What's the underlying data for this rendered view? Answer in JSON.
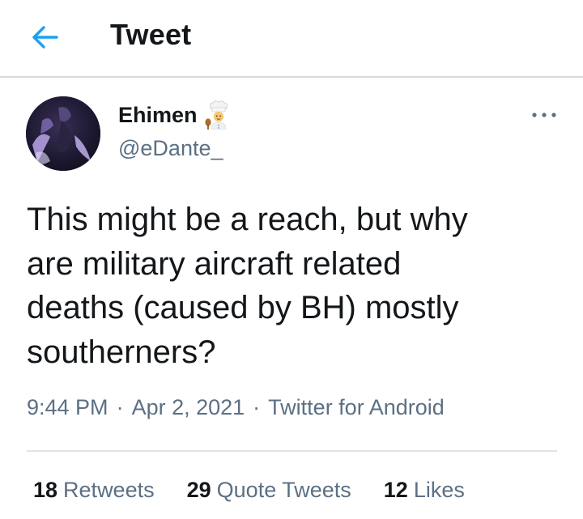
{
  "header": {
    "title": "Tweet",
    "back_icon": "arrow-left-icon"
  },
  "colors": {
    "accent": "#1da1f2",
    "text": "#14171a",
    "secondary": "#5b7083",
    "divider": "#e1e5e8"
  },
  "tweet": {
    "author": {
      "display_name": "Ehimen",
      "name_emoji": "cook-emoji",
      "handle": "@eDante_"
    },
    "text": "This might be a reach, but why\nare military aircraft related\ndeaths (caused by BH) mostly\nsoutherners?",
    "time": "9:44 PM",
    "date": "Apr 2, 2021",
    "source": "Twitter for Android",
    "separator": "·",
    "stats": {
      "retweets_count": "18",
      "retweets_label": "Retweets",
      "quotes_count": "29",
      "quotes_label": "Quote Tweets",
      "likes_count": "12",
      "likes_label": "Likes"
    }
  }
}
